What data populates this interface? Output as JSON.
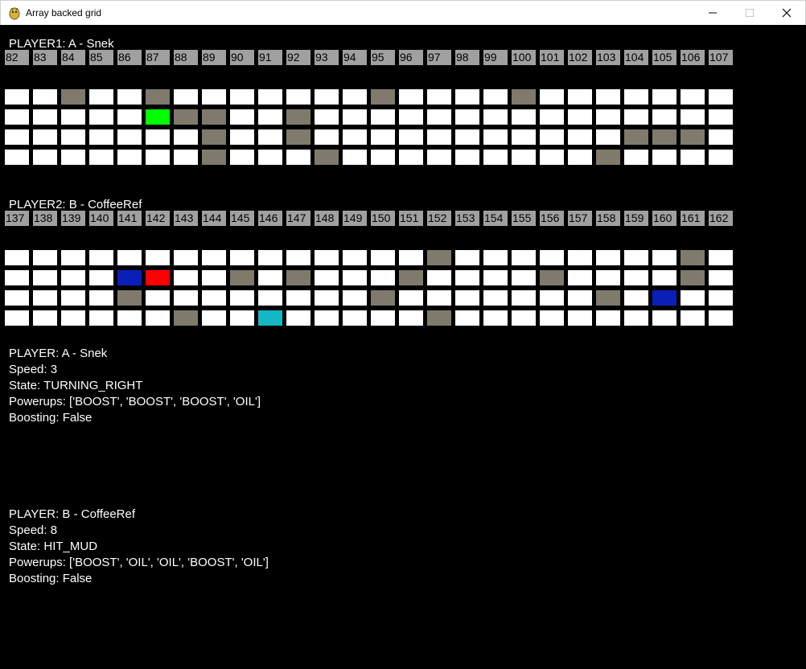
{
  "window": {
    "title": "Array backed grid"
  },
  "colors": {
    "empty": "#ffffff",
    "mud": "#7f7a6b",
    "player1": "#00ff00",
    "player2": "#ff0000",
    "oil": "#0a1fb8",
    "boost": "#14b8c4",
    "lane_number_bg": "#a0a0a0"
  },
  "players": [
    {
      "label": "PLAYER1: A - Snek",
      "blocks": [
        "82",
        "83",
        "84",
        "85",
        "86",
        "87",
        "88",
        "89",
        "90",
        "91",
        "92",
        "93",
        "94",
        "95",
        "96",
        "97",
        "98",
        "99",
        "100",
        "101",
        "102",
        "103",
        "104",
        "105",
        "106",
        "107"
      ],
      "lanes": [
        "EEMEEMEEEEEEEMEEEEMEEEEEEE",
        "EEEEEPMMEEMEEEEEEEEEEEEEEE",
        "EEEEEEEMEEMEEEEEEEEEEEMMME",
        "EEEEEEEMEEEMEEEEEEEEEMEEEE"
      ]
    },
    {
      "label": "PLAYER2: B - CoffeeRef",
      "blocks": [
        "137",
        "138",
        "139",
        "140",
        "141",
        "142",
        "143",
        "144",
        "145",
        "146",
        "147",
        "148",
        "149",
        "150",
        "151",
        "152",
        "153",
        "154",
        "155",
        "156",
        "157",
        "158",
        "159",
        "160",
        "161",
        "162"
      ],
      "lanes": [
        "EEEEEEEEEEEEEEEMEEEEEEEEME",
        "EEEEOQEEMEMEEEMEEEEMEEEEME",
        "EEEEMEEEEEEEEMEEEEEEEMEOEE",
        "EEEEEEMEEBEEEEEMEEEEEEEEEE"
      ]
    }
  ],
  "info": [
    {
      "player": "PLAYER: A - Snek",
      "speed": "Speed: 3",
      "state": "State: TURNING_RIGHT",
      "powerups": "Powerups: ['BOOST', 'BOOST', 'BOOST', 'OIL']",
      "boosting": "Boosting: False"
    },
    {
      "player": "PLAYER: B - CoffeeRef",
      "speed": "Speed: 8",
      "state": "State: HIT_MUD",
      "powerups": "Powerups: ['BOOST', 'OIL', 'OIL', 'BOOST', 'OIL']",
      "boosting": "Boosting: False"
    }
  ]
}
